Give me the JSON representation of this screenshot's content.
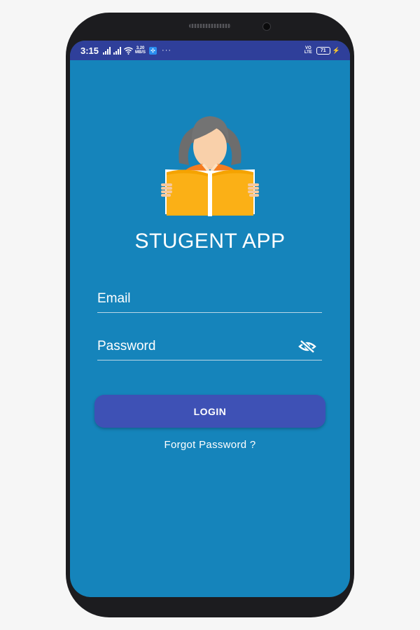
{
  "status_bar": {
    "time": "3:15",
    "net_speed_value": "3.20",
    "net_speed_unit": "MB/S",
    "more": "···",
    "volte_top": "VO",
    "volte_bottom": "LTE",
    "battery": "71",
    "bolt": "⚡",
    "vpn": "✣"
  },
  "app": {
    "title": "STUGENT APP"
  },
  "form": {
    "email_placeholder": "Email",
    "password_placeholder": "Password",
    "login_label": "LOGIN",
    "forgot_label": "Forgot Password ?"
  },
  "colors": {
    "screen_bg": "#1584bb",
    "status_bar": "#2f3f9a",
    "button": "#3e51b5"
  },
  "icons": {
    "logo": "student-reading-book-icon",
    "password_toggle": "eye-off-icon"
  }
}
